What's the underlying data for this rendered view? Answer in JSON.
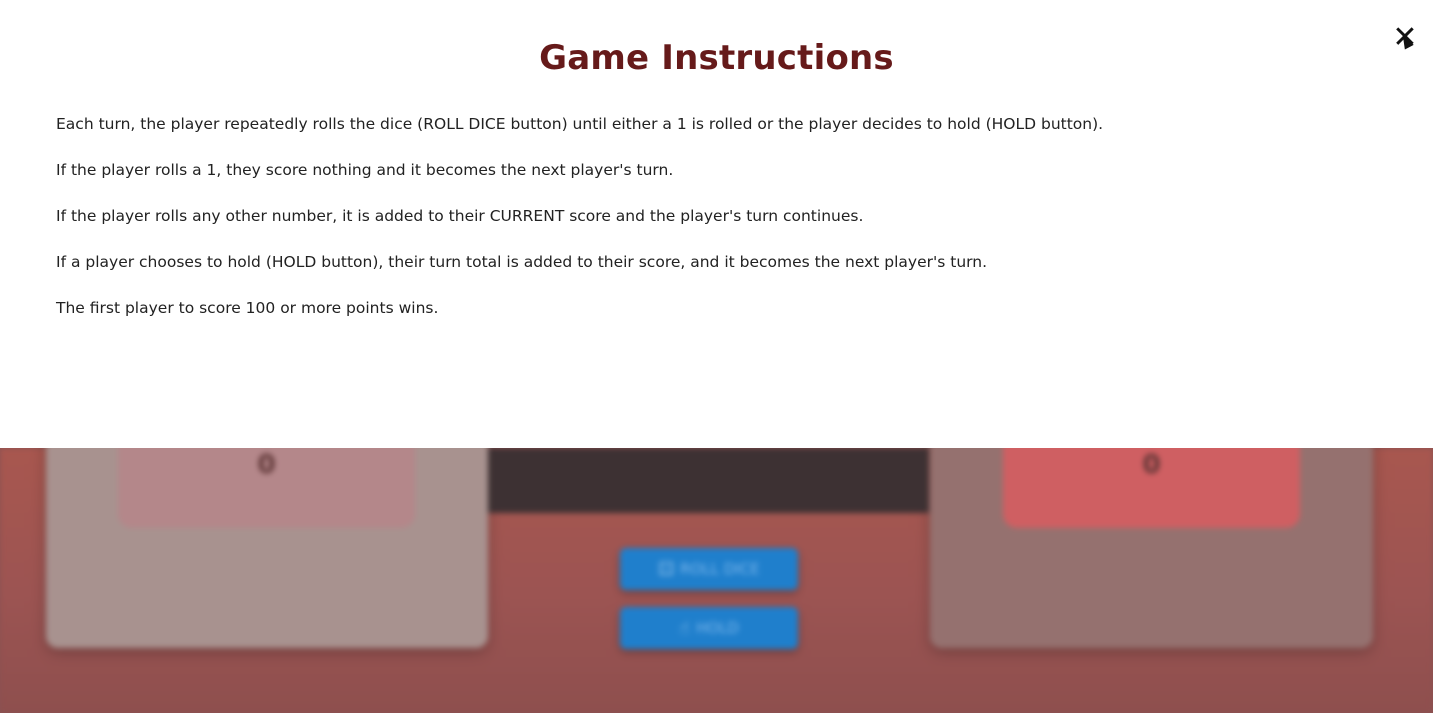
{
  "modal": {
    "title": "Game Instructions",
    "close_label": "✕",
    "rules": [
      "Each turn, the player repeatedly rolls the dice (ROLL DICE button) until either a 1 is rolled or the player decides to hold (HOLD button).",
      "If the player rolls a 1, they score nothing and it becomes the next player's turn.",
      "If the player rolls any other number, it is added to their CURRENT score and the player's turn continues.",
      "If a player chooses to hold (HOLD button), their turn total is added to their score, and it becomes the next player's turn.",
      "The first player to score 100 or more points wins."
    ]
  },
  "game": {
    "player1_current": "0",
    "player2_current": "0",
    "roll_label": "ROLL DICE",
    "hold_label": "HOLD",
    "roll_icon": "dice-icon",
    "hold_icon": "hand-pointer-icon"
  },
  "colors": {
    "title": "#661a1a",
    "button": "#1f7fcc",
    "background": "#9c5452"
  }
}
